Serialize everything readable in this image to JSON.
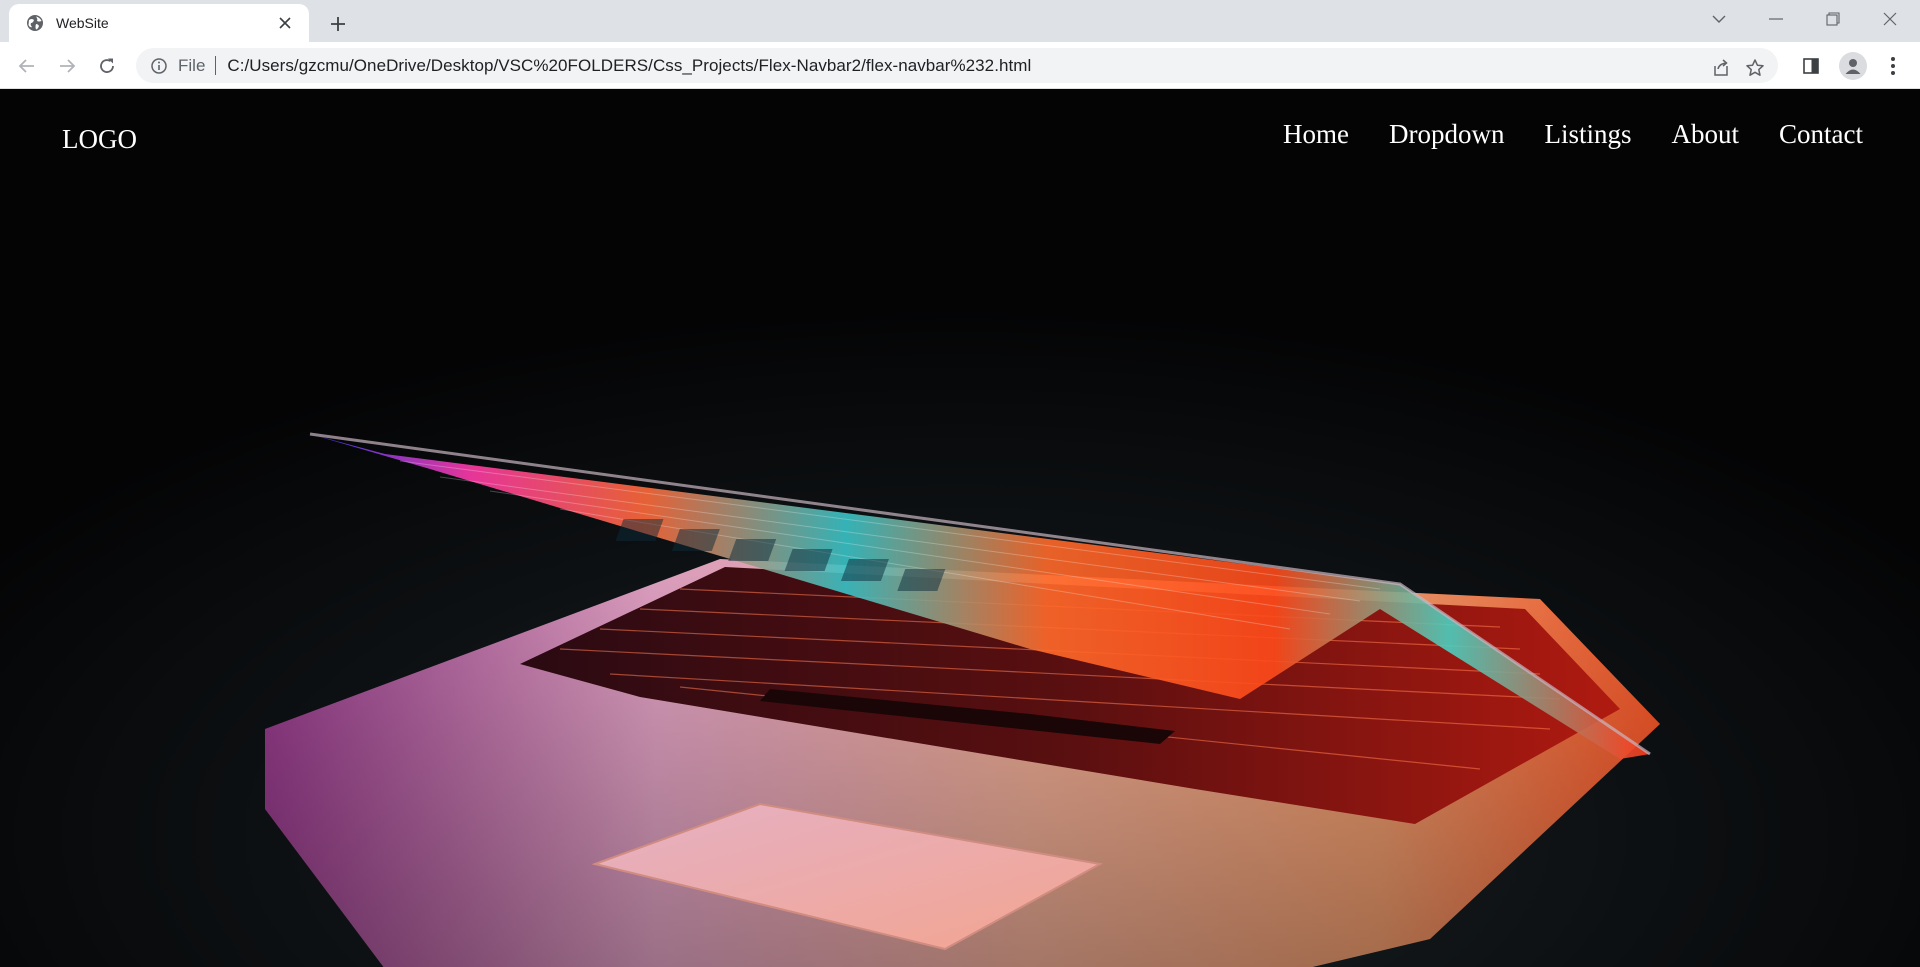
{
  "browser": {
    "tab": {
      "title": "WebSite"
    },
    "omnibox": {
      "scheme_label": "File",
      "url": "C:/Users/gzcmu/OneDrive/Desktop/VSC%20FOLDERS/Css_Projects/Flex-Navbar2/flex-navbar%232.html"
    },
    "icons": {
      "tab_favicon": "globe-icon",
      "tab_close": "close-icon",
      "new_tab": "plus-icon",
      "back": "back-arrow-icon",
      "forward": "forward-arrow-icon",
      "reload": "reload-icon",
      "site_info": "info-icon",
      "share": "share-icon",
      "bookmark": "star-icon",
      "side_panel": "side-panel-icon",
      "profile": "profile-icon",
      "menu": "kebab-menu-icon",
      "tab_search": "chevron-down-icon",
      "minimize": "minimize-icon",
      "restore": "restore-icon",
      "close_window": "close-icon"
    }
  },
  "site": {
    "logo": "LOGO",
    "nav": [
      {
        "label": "Home"
      },
      {
        "label": "Dropdown"
      },
      {
        "label": "Listings"
      },
      {
        "label": "About"
      },
      {
        "label": "Contact"
      }
    ],
    "hero_image": "laptop-keyboard-glowing-photo"
  },
  "colors": {
    "tabstrip": "#dee1e6",
    "page_background": "#050507",
    "nav_text": "#ffffff"
  }
}
